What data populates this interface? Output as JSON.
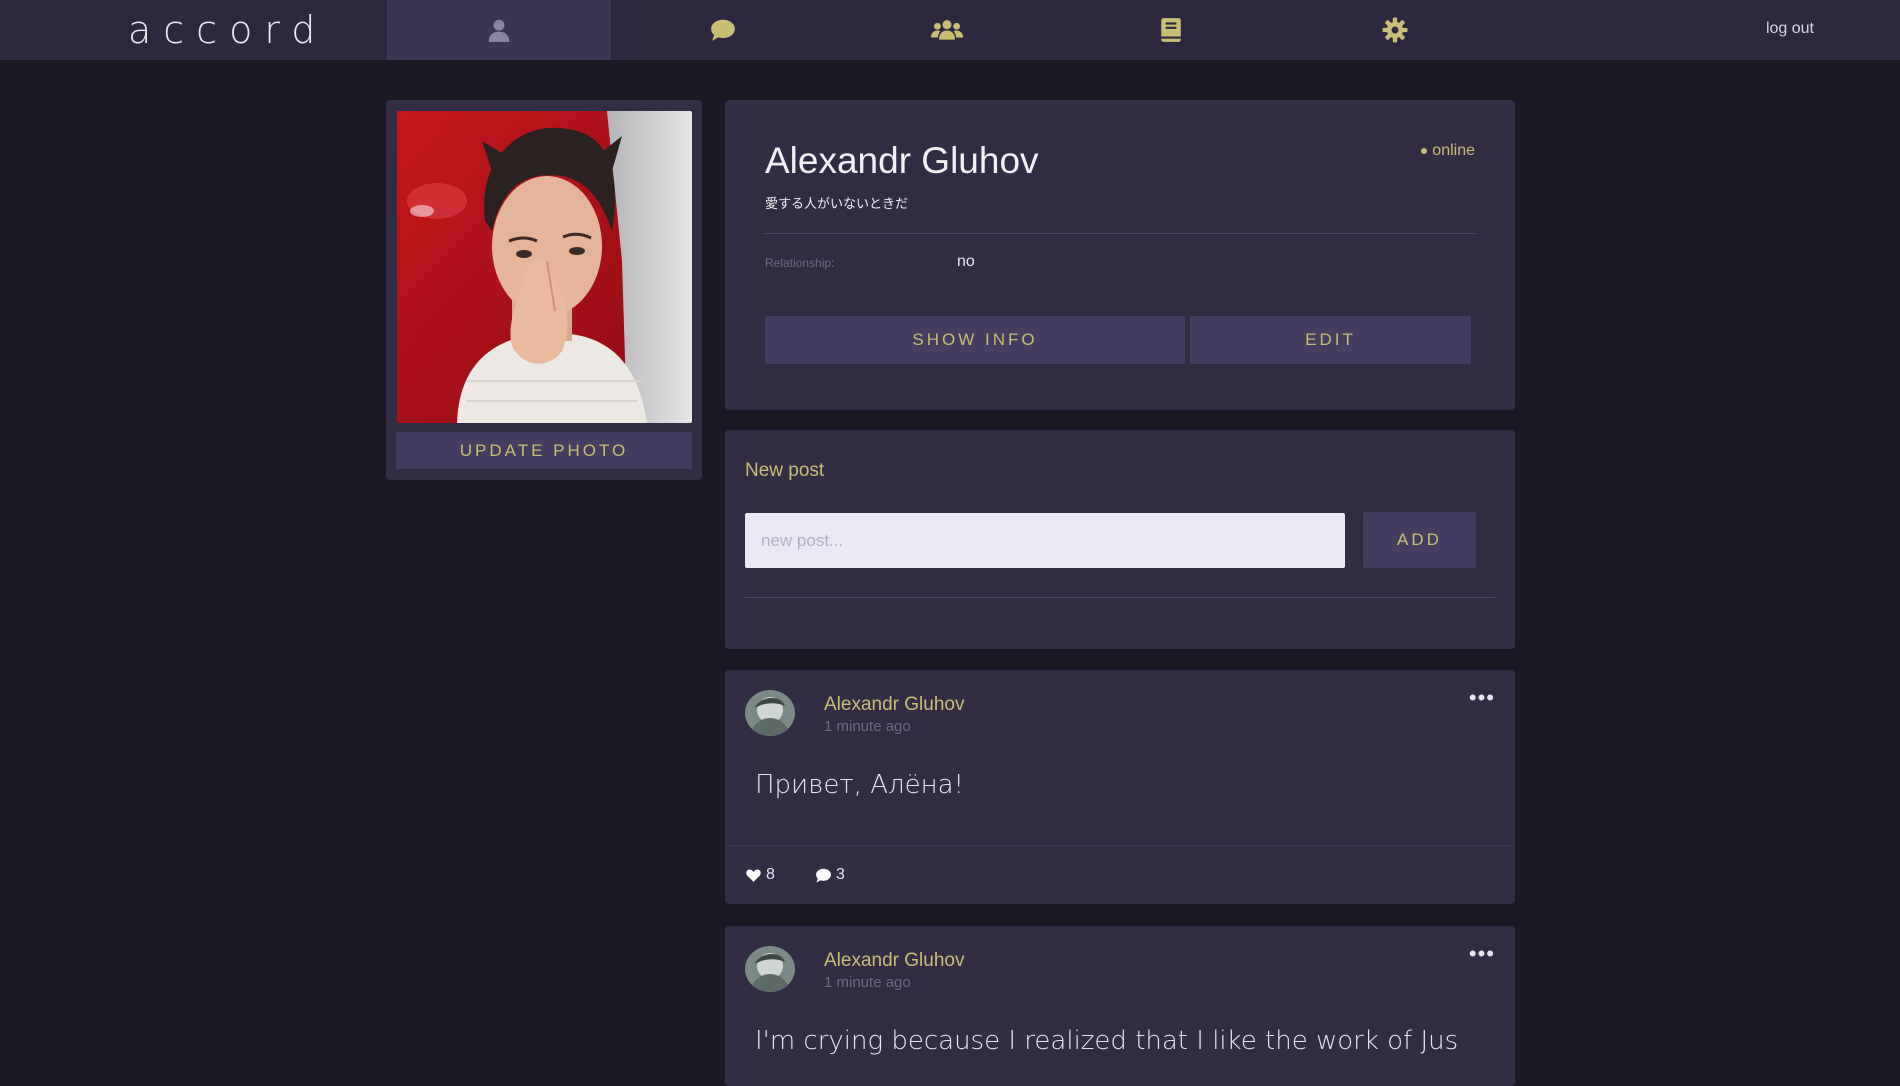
{
  "app": {
    "logo": "accord"
  },
  "nav": {
    "tabs": [
      {
        "icon": "user-icon",
        "active": true
      },
      {
        "icon": "chat-icon",
        "active": false
      },
      {
        "icon": "users-icon",
        "active": false
      },
      {
        "icon": "book-icon",
        "active": false
      },
      {
        "icon": "gear-icon",
        "active": false
      }
    ],
    "logout_label": "log out",
    "icon_color": "#c9be73",
    "active_icon_color": "#8a849f"
  },
  "profile": {
    "name": "Alexandr Gluhov",
    "status": "愛する人がいないときだ",
    "online_label": "online",
    "relationship_label": "Relationship:",
    "relationship_value": "no",
    "show_info_label": "SHOW INFO",
    "edit_label": "EDIT",
    "update_photo_label": "UPDATE PHOTO"
  },
  "new_post": {
    "title": "New post",
    "placeholder": "new post...",
    "add_label": "ADD"
  },
  "posts": [
    {
      "author": "Alexandr Gluhov",
      "time": "1 minute ago",
      "text": "Привет, Алёна!",
      "likes": "8",
      "comments": "3",
      "more": "•••"
    },
    {
      "author": "Alexandr Gluhov",
      "time": "1 minute ago",
      "text": "I'm crying because I realized that I like the work of Jus",
      "more": "•••"
    }
  ],
  "colors": {
    "background": "#1b1826",
    "card": "#322c45",
    "accent": "#c9be73",
    "button": "#453d61"
  }
}
